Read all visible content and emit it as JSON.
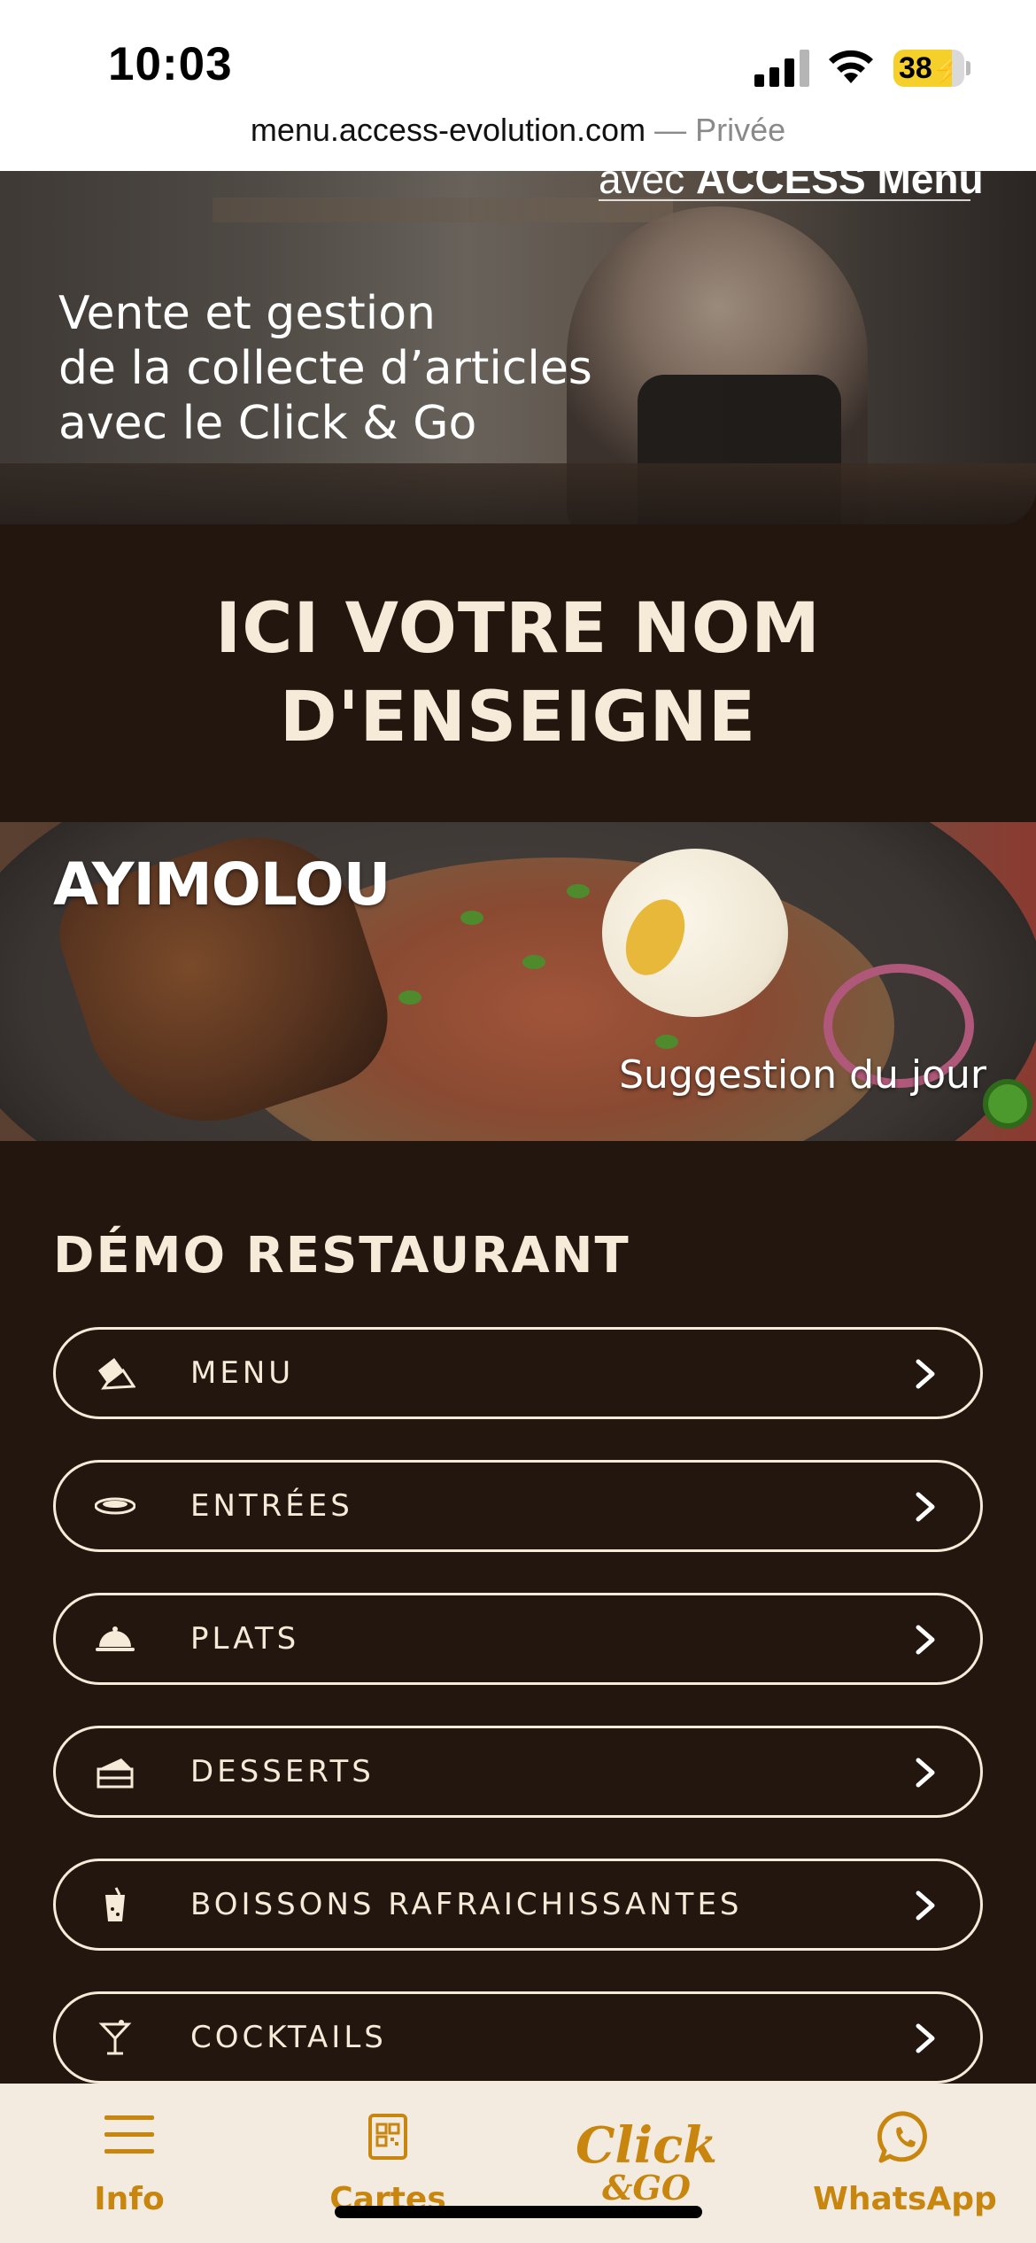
{
  "status_bar": {
    "time": "10:03",
    "battery_level": "38"
  },
  "browser": {
    "domain": "menu.access-evolution.com",
    "separator": "—",
    "mode": "Privée"
  },
  "hero": {
    "top_line_prefix": "avec",
    "top_line_brand": "ACCESS Menu",
    "tagline": "Vente et gestion\nde la collecte d’articles\navec le Click & Go"
  },
  "brand_title": "ICI VOTRE NOM\nD'ENSEIGNE",
  "suggestion": {
    "dish_name": "AYIMOLOU",
    "caption": "Suggestion du jour"
  },
  "restaurant": {
    "title": "DÉMO RESTAURANT",
    "items": [
      {
        "label": "MENU",
        "icon": "menu-book-icon"
      },
      {
        "label": "ENTRÉES",
        "icon": "plate-icon"
      },
      {
        "label": "PLATS",
        "icon": "cloche-icon"
      },
      {
        "label": "DESSERTS",
        "icon": "cake-icon"
      },
      {
        "label": "BOISSONS RAFRAICHISSANTES",
        "icon": "drink-icon"
      },
      {
        "label": "COCKTAILS",
        "icon": "cocktail-icon"
      }
    ]
  },
  "tab_bar": {
    "info": "Info",
    "cartes": "Cartes",
    "click_go_main": "Click",
    "click_go_sub": "&GO",
    "whatsapp": "WhatsApp"
  },
  "colors": {
    "background": "#22160f",
    "cream": "#f6ead9",
    "accent": "#c9860f",
    "tab_bar_bg": "#f4ebe0"
  }
}
